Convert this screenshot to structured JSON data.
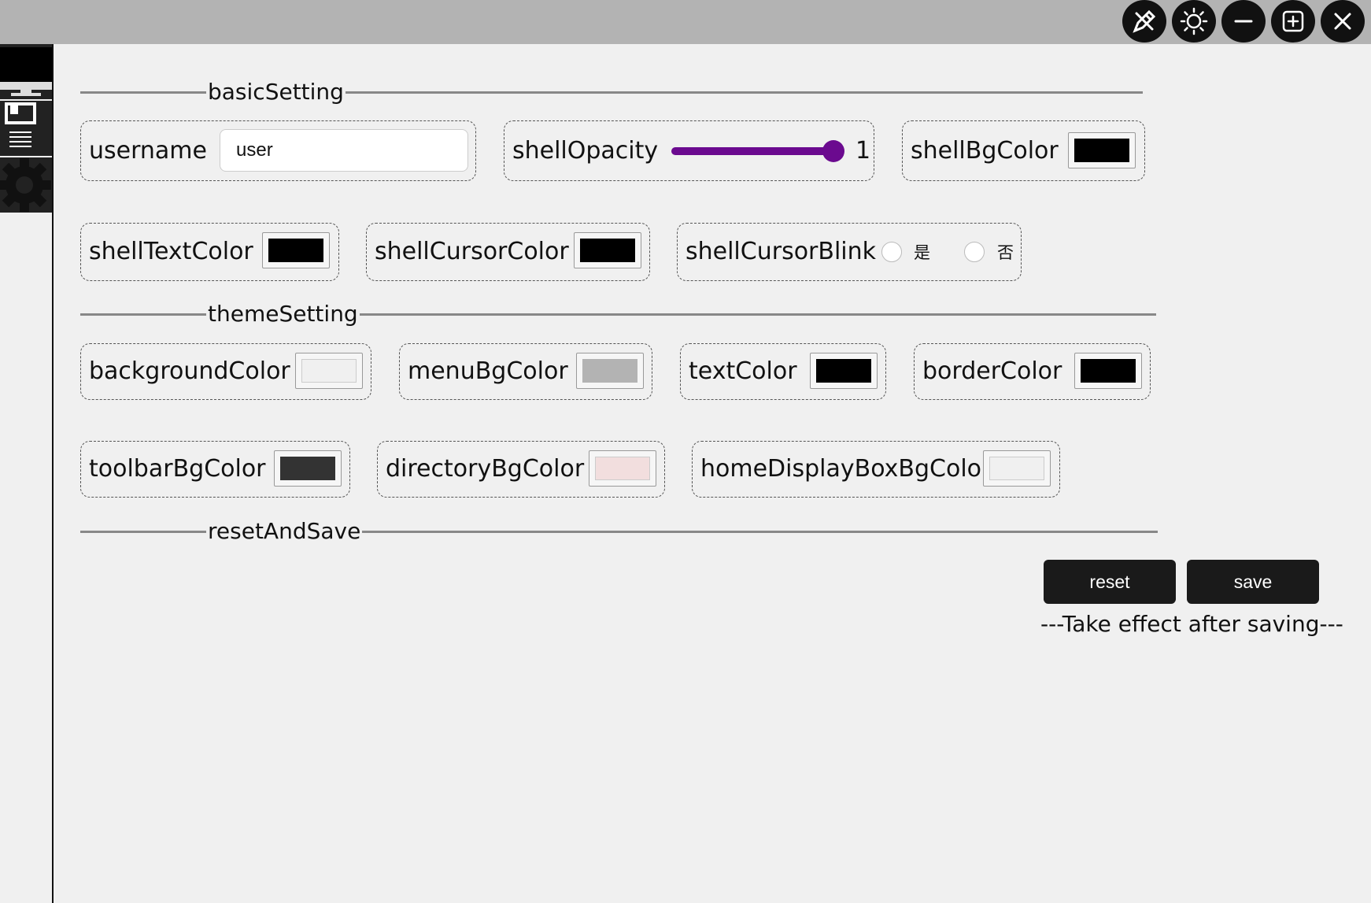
{
  "titlebar": {
    "buttons": [
      {
        "name": "edit-tools-icon"
      },
      {
        "name": "theme-sun-icon"
      },
      {
        "name": "minimize-icon"
      },
      {
        "name": "maximize-icon"
      },
      {
        "name": "close-icon"
      }
    ]
  },
  "sidebar": {
    "items": [
      {
        "name": "monitor-icon"
      },
      {
        "name": "save-list-icon"
      },
      {
        "name": "gear-icon"
      }
    ]
  },
  "sections": {
    "basic": "basicSetting",
    "theme": "themeSetting",
    "reset": "resetAndSave"
  },
  "basic": {
    "username_label": "username",
    "username_value": "user",
    "opacity_label": "shellOpacity",
    "opacity_value": "1",
    "opacity_fraction": 1,
    "bg_label": "shellBgColor",
    "text_label": "shellTextColor",
    "cursor_label": "shellCursorColor",
    "blink_label": "shellCursorBlink",
    "blink_yes": "是",
    "blink_no": "否"
  },
  "theme": {
    "background_label": "backgroundColor",
    "menu_label": "menuBgColor",
    "text_label": "textColor",
    "border_label": "borderColor",
    "toolbar_label": "toolbarBgColor",
    "directory_label": "directoryBgColor",
    "home_label": "homeDisplayBoxBgColor"
  },
  "colors": {
    "shellBgColor": "#000000",
    "shellTextColor": "#000000",
    "shellCursorColor": "#000000",
    "backgroundColor": "#f0f0f0",
    "menuBgColor": "#b3b3b3",
    "textColor": "#000000",
    "borderColor": "#000000",
    "toolbarBgColor": "#333333",
    "directoryBgColor": "#f2dede",
    "homeDisplayBoxBgColor": "#f0f0f0",
    "accent": "#6b0a8f"
  },
  "actions": {
    "reset": "reset",
    "save": "save",
    "note": "---Take effect after saving---"
  }
}
